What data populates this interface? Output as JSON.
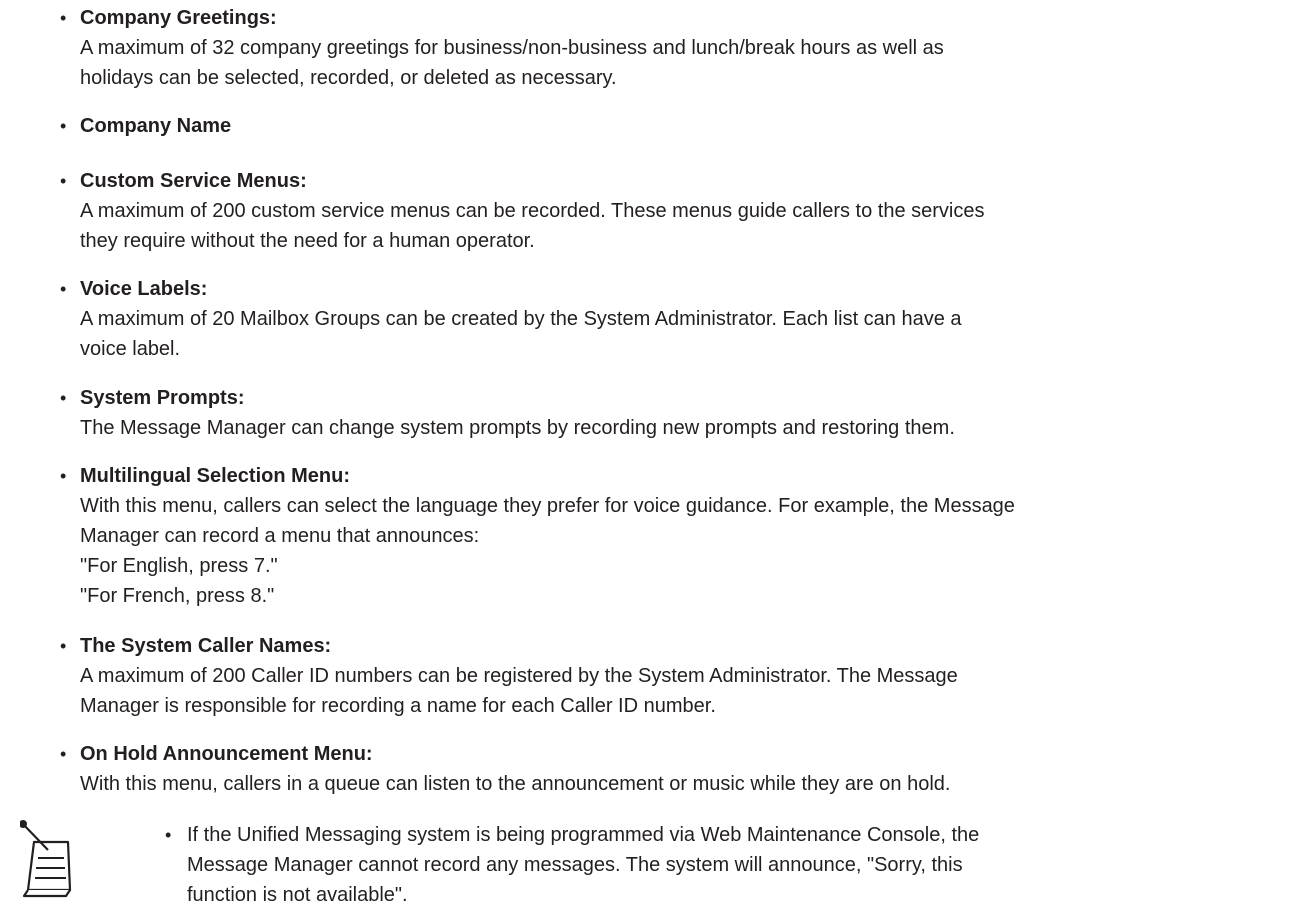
{
  "items": [
    {
      "bullet": "•",
      "title": "Company Greetings:",
      "lines": [
        "A maximum of 32 company greetings for business/non-business and lunch/break hours as well as",
        "holidays can be selected, recorded, or deleted as necessary."
      ]
    },
    {
      "bullet": "•",
      "title": "Company Name",
      "lines": []
    },
    {
      "bullet": "•",
      "title": "Custom Service Menus:",
      "lines": [
        "A maximum of 200 custom service menus can be recorded. These menus guide callers to the services",
        "they require without the need for a human operator."
      ]
    },
    {
      "bullet": "•",
      "title": "Voice Labels:",
      "lines": [
        "A maximum of 20 Mailbox Groups can be created by the System Administrator. Each list can have a",
        "voice label."
      ]
    },
    {
      "bullet": "•",
      "title": "System Prompts:",
      "lines": [
        "The Message Manager can change system prompts by recording new prompts and restoring them."
      ]
    },
    {
      "bullet": "•",
      "title": "Multilingual Selection Menu:",
      "lines": [
        "With this menu, callers can select the language they prefer for voice guidance. For example, the Message",
        "Manager can record a menu that announces:",
        "\"For English, press 7.\"",
        "\"For French, press 8.\""
      ]
    },
    {
      "bullet": "•",
      "title": "The System Caller Names:",
      "lines": [
        "A maximum of 200 Caller ID numbers can be registered by the System Administrator. The Message",
        "Manager is responsible for recording a name for each Caller ID number."
      ]
    },
    {
      "bullet": "•",
      "title": "On Hold Announcement Menu:",
      "lines": [
        "With this menu, callers in a queue can listen to the announcement or music while they are on hold."
      ]
    }
  ],
  "note": {
    "icon": "notepad-pencil-icon",
    "bullet": "•",
    "lines": [
      "If the Unified Messaging system is being programmed via Web Maintenance Console, the",
      "Message Manager cannot record any messages. The system will announce, \"Sorry, this",
      "function is not available\"."
    ]
  }
}
